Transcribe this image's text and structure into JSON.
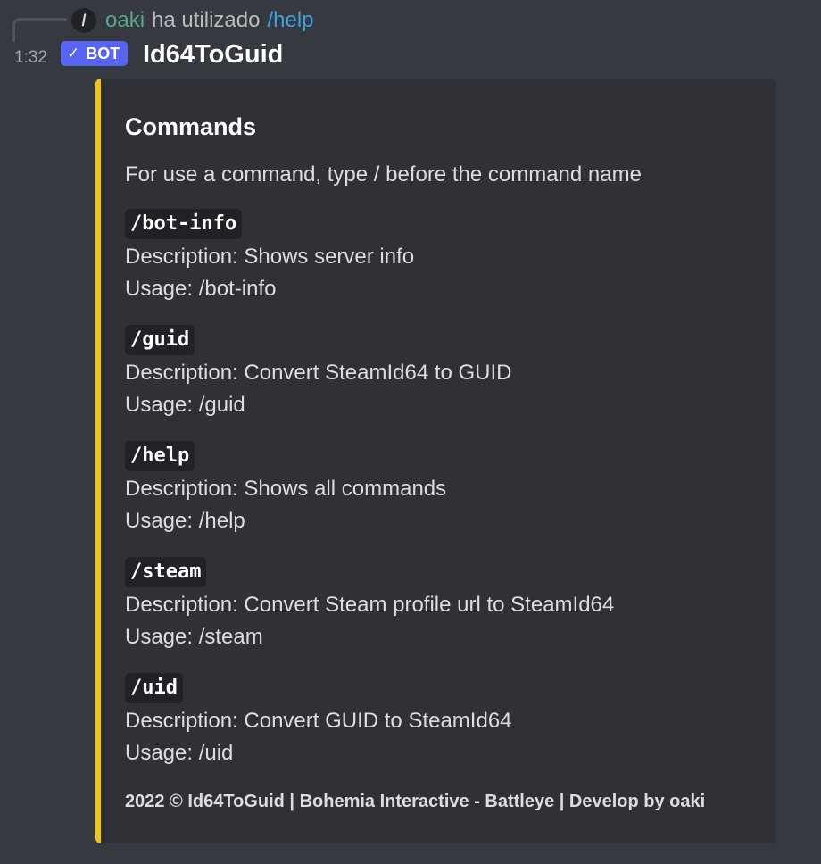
{
  "reply": {
    "icon": "slash-command-icon",
    "icon_glyph": "/",
    "user": "oaki",
    "text": "ha utilizado",
    "command": "/help"
  },
  "message": {
    "timestamp": "1:32",
    "bot_tag": "BOT",
    "author": "Id64ToGuid"
  },
  "embed": {
    "accent_color": "#f1c40f",
    "title": "Commands",
    "description": "For use a command, type / before the command name",
    "commands": [
      {
        "name": "/bot-info",
        "description": "Description: Shows server info",
        "usage": "Usage: /bot-info"
      },
      {
        "name": "/guid",
        "description": "Description: Convert SteamId64 to GUID",
        "usage": "Usage: /guid"
      },
      {
        "name": "/help",
        "description": "Description: Shows all commands",
        "usage": "Usage: /help"
      },
      {
        "name": "/steam",
        "description": "Description: Convert Steam profile url to SteamId64",
        "usage": "Usage: /steam"
      },
      {
        "name": "/uid",
        "description": "Description: Convert GUID to SteamId64",
        "usage": "Usage: /uid"
      }
    ],
    "footer": "2022 © Id64ToGuid | Bohemia Interactive - Battleye | Develop by oaki"
  }
}
